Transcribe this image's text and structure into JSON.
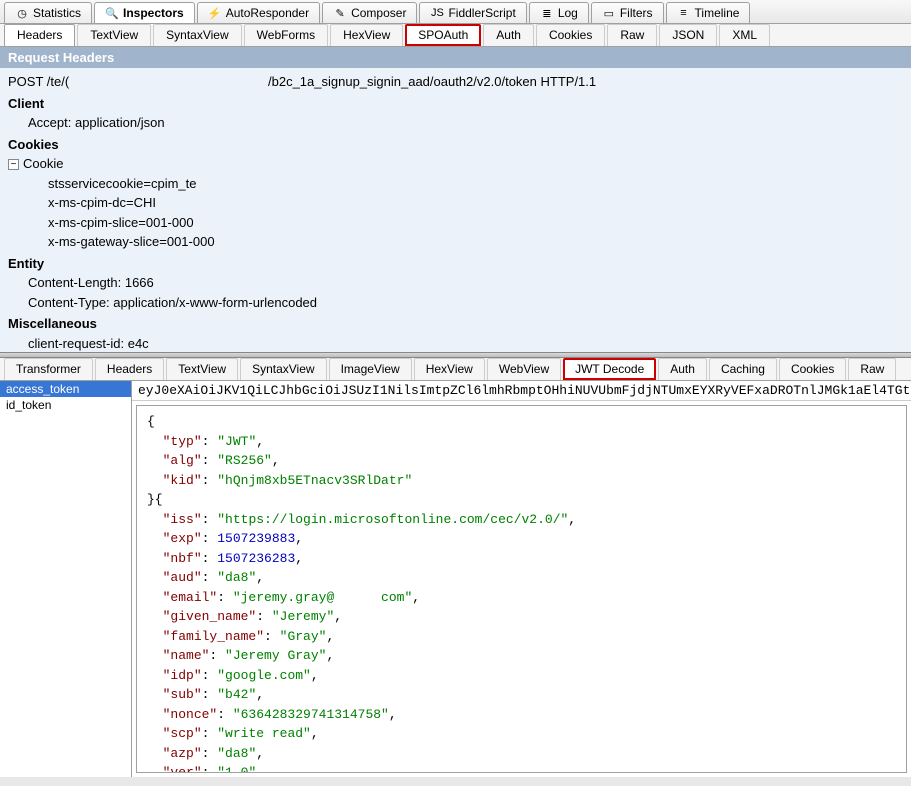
{
  "mainTabs": [
    {
      "label": "Statistics",
      "icon": "◷",
      "active": false
    },
    {
      "label": "Inspectors",
      "icon": "🔍",
      "active": true
    },
    {
      "label": "AutoResponder",
      "icon": "⚡",
      "active": false
    },
    {
      "label": "Composer",
      "icon": "✎",
      "active": false
    },
    {
      "label": "FiddlerScript",
      "icon": "JS",
      "active": false
    },
    {
      "label": "Log",
      "icon": "≣",
      "active": false
    },
    {
      "label": "Filters",
      "icon": "▭",
      "active": false
    },
    {
      "label": "Timeline",
      "icon": "≡",
      "active": false
    }
  ],
  "reqTabs": [
    "Headers",
    "TextView",
    "SyntaxView",
    "WebForms",
    "HexView",
    "SPOAuth",
    "Auth",
    "Cookies",
    "Raw",
    "JSON",
    "XML"
  ],
  "reqHighlight": "SPOAuth",
  "reqActive": "Headers",
  "sectionTitle": "Request Headers",
  "requestLine": {
    "method": "POST /te/(",
    "path": "/b2c_1a_signup_signin_aad/oauth2/v2.0/token HTTP/1.1"
  },
  "headerGroups": [
    {
      "name": "Client",
      "items": [
        "Accept: application/json"
      ]
    },
    {
      "name": "Cookies",
      "expand": true,
      "sub": "Cookie",
      "items": [
        "stsservicecookie=cpim_te",
        "x-ms-cpim-dc=CHI",
        "x-ms-cpim-slice=001-000",
        "x-ms-gateway-slice=001-000"
      ]
    },
    {
      "name": "Entity",
      "items": [
        "Content-Length: 1666",
        "Content-Type: application/x-www-form-urlencoded"
      ]
    },
    {
      "name": "Miscellaneous",
      "items": [
        "client-request-id: e4c"
      ]
    }
  ],
  "respTabs": [
    "Transformer",
    "Headers",
    "TextView",
    "SyntaxView",
    "ImageView",
    "HexView",
    "WebView",
    "JWT Decode",
    "Auth",
    "Caching",
    "Cookies",
    "Raw"
  ],
  "respHighlight": "JWT Decode",
  "tokens": [
    {
      "name": "access_token",
      "selected": true
    },
    {
      "name": "id_token",
      "selected": false
    }
  ],
  "rawToken": "eyJ0eXAiOiJKV1QiLCJhbGciOiJSUzI1NilsImtpZCl6lmhRbmptOHhiNUVUbmFjdjNTUmxEYXRyVEFxaDROTnlJMGk1aEl4TGt",
  "decoded": {
    "header": {
      "typ": "JWT",
      "alg": "RS256",
      "kid": "hQnjm8xb5ETnacv3SRlDatr"
    },
    "payload": {
      "iss": "https://login.microsoftonline.com/cec/v2.0/",
      "exp": 1507239883,
      "nbf": 1507236283,
      "aud": "da8",
      "email": "jeremy.gray@      com",
      "given_name": "Jeremy",
      "family_name": "Gray",
      "name": "Jeremy Gray",
      "idp": "google.com",
      "sub": "b42",
      "nonce": "636428329741314758",
      "scp": "write read",
      "azp": "da8",
      "ver": "1.0"
    }
  }
}
